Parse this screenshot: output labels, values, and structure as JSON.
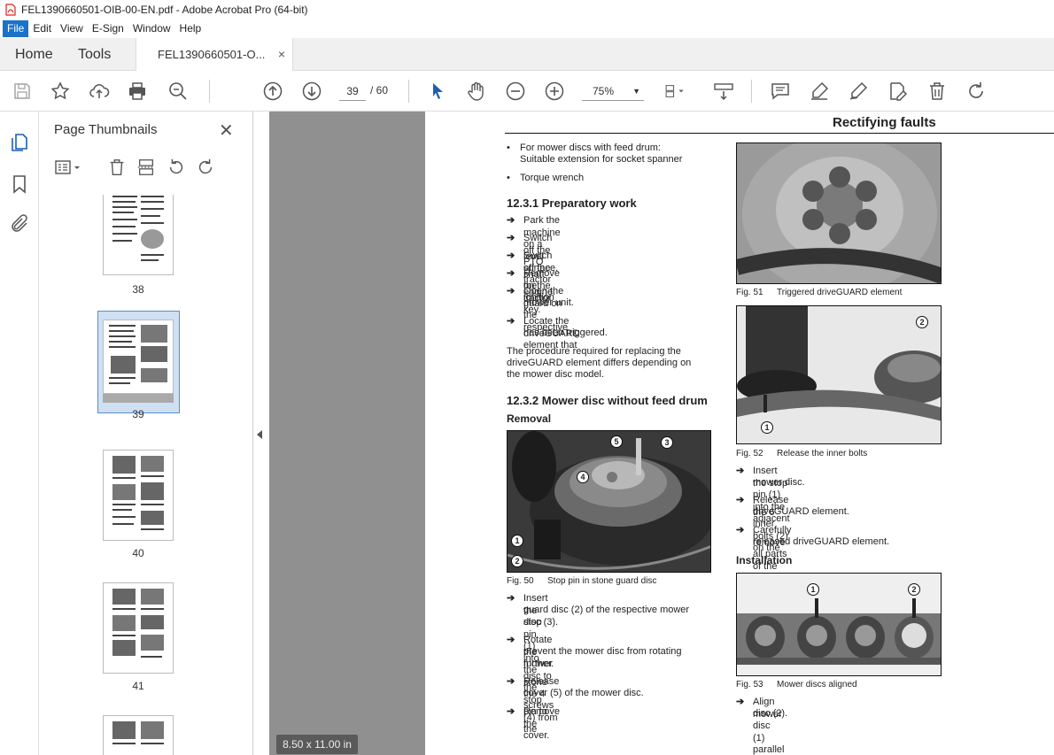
{
  "window": {
    "title": "FEL1390660501-OIB-00-EN.pdf - Adobe Acrobat Pro (64-bit)"
  },
  "menu": [
    "File",
    "Edit",
    "View",
    "E-Sign",
    "Window",
    "Help"
  ],
  "tabs": {
    "home": "Home",
    "tools": "Tools",
    "document": "FEL1390660501-O...",
    "close": "×"
  },
  "toolbar": {
    "page_current": "39",
    "page_total": "/  60",
    "zoom": "75%"
  },
  "thumbnails": {
    "title": "Page Thumbnails",
    "close": "✕",
    "pages": [
      "38",
      "39",
      "40",
      "41"
    ],
    "selected": "39"
  },
  "viewer": {
    "page_size": "8.50 x 11.00 in"
  },
  "doc": {
    "header": "Rectifying faults",
    "bullets_top": [
      "For mower discs with feed drum:",
      "Suitable extension for socket spanner",
      "Torque wrench"
    ],
    "h_prep": "12.3.1 Preparatory work",
    "prep_steps": [
      "Park the machine on a level surface.",
      "Switch off the PTO shaft on the tractor.",
      "Switch off the tractor engine.",
      "Remove the ignition key.",
      "Open the guard on the respective",
      "mower unit.",
      "Locate the driveGUARD element that",
      "has been triggered."
    ],
    "procedure_text": [
      "The procedure required for replacing the",
      "driveGUARD element differs depending on",
      "the mower disc model."
    ],
    "h_mower": "12.3.2 Mower disc without feed drum",
    "h_removal": "Removal",
    "fig50": {
      "num": "Fig. 50",
      "caption": "Stop pin in stone guard disc"
    },
    "removal_steps": [
      "Insert the stop pin (1) into the stone",
      "guard disc (2) of the respective mower",
      "disc (3).",
      "Rotate the mower disc to the stop pin to",
      "prevent the mower disc from rotating",
      "further.",
      "Release the 4 screws (4) from the",
      "cover (5) of the mower disc.",
      "Remove the cover."
    ],
    "fig51": {
      "num": "Fig. 51",
      "caption": "Triggered driveGUARD element"
    },
    "fig52": {
      "num": "Fig. 52",
      "caption": "Release the inner bolts"
    },
    "right_steps": [
      "Insert the stop pin (1) into the adjacent",
      "mower disc.",
      "Release the 6 inner bolts (2) on the",
      "driveGUARD element.",
      "Carefully remove all parts of the",
      "released driveGUARD element."
    ],
    "h_installation": "Installation",
    "fig53": {
      "num": "Fig. 53",
      "caption": "Mower discs aligned"
    },
    "install_steps": [
      "Align mower disc (1) parallel to mower",
      "disc (2)."
    ],
    "callouts": [
      "1",
      "2",
      "3",
      "4",
      "5"
    ]
  }
}
